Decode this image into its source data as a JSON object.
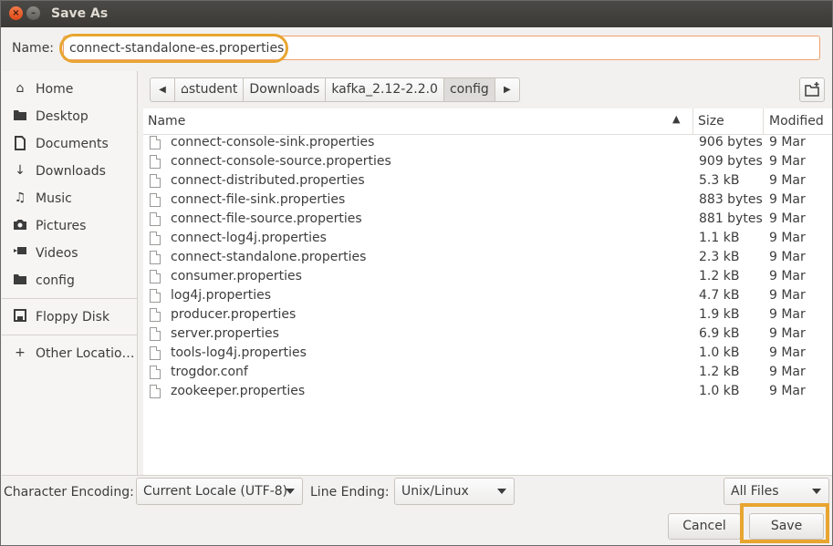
{
  "window": {
    "title": "Save As"
  },
  "name_row": {
    "label": "Name:",
    "value": "connect-standalone-es.properties"
  },
  "sidebar": {
    "items": [
      {
        "label": "Home",
        "icon": "home-icon"
      },
      {
        "label": "Desktop",
        "icon": "folder-icon"
      },
      {
        "label": "Documents",
        "icon": "document-icon"
      },
      {
        "label": "Downloads",
        "icon": "download-icon"
      },
      {
        "label": "Music",
        "icon": "music-icon"
      },
      {
        "label": "Pictures",
        "icon": "camera-icon"
      },
      {
        "label": "Videos",
        "icon": "video-icon"
      },
      {
        "label": "config",
        "icon": "folder-icon"
      },
      {
        "label": "Floppy Disk",
        "icon": "floppy-icon"
      },
      {
        "label": "Other Locatio…",
        "icon": "plus-icon"
      }
    ]
  },
  "pathbar": {
    "segments": [
      "student",
      "Downloads",
      "kafka_2.12-2.2.0",
      "config"
    ]
  },
  "columns": {
    "name": "Name",
    "size": "Size",
    "modified": "Modified"
  },
  "files": [
    {
      "name": "connect-console-sink.properties",
      "size": "906 bytes",
      "modified": "9 Mar"
    },
    {
      "name": "connect-console-source.properties",
      "size": "909 bytes",
      "modified": "9 Mar"
    },
    {
      "name": "connect-distributed.properties",
      "size": "5.3 kB",
      "modified": "9 Mar"
    },
    {
      "name": "connect-file-sink.properties",
      "size": "883 bytes",
      "modified": "9 Mar"
    },
    {
      "name": "connect-file-source.properties",
      "size": "881 bytes",
      "modified": "9 Mar"
    },
    {
      "name": "connect-log4j.properties",
      "size": "1.1 kB",
      "modified": "9 Mar"
    },
    {
      "name": "connect-standalone.properties",
      "size": "2.3 kB",
      "modified": "9 Mar"
    },
    {
      "name": "consumer.properties",
      "size": "1.2 kB",
      "modified": "9 Mar"
    },
    {
      "name": "log4j.properties",
      "size": "4.7 kB",
      "modified": "9 Mar"
    },
    {
      "name": "producer.properties",
      "size": "1.9 kB",
      "modified": "9 Mar"
    },
    {
      "name": "server.properties",
      "size": "6.9 kB",
      "modified": "9 Mar"
    },
    {
      "name": "tools-log4j.properties",
      "size": "1.0 kB",
      "modified": "9 Mar"
    },
    {
      "name": "trogdor.conf",
      "size": "1.2 kB",
      "modified": "9 Mar"
    },
    {
      "name": "zookeeper.properties",
      "size": "1.0 kB",
      "modified": "9 Mar"
    }
  ],
  "bottom": {
    "encoding_label": "Character Encoding:",
    "encoding_value": "Current Locale (UTF-8)",
    "line_ending_label": "Line Ending:",
    "line_ending_value": "Unix/Linux",
    "filter_value": "All Files"
  },
  "buttons": {
    "cancel": "Cancel",
    "save": "Save"
  },
  "colors": {
    "highlight": "#e8a530",
    "titlebar": "#3b3a36",
    "close": "#df4a16"
  }
}
